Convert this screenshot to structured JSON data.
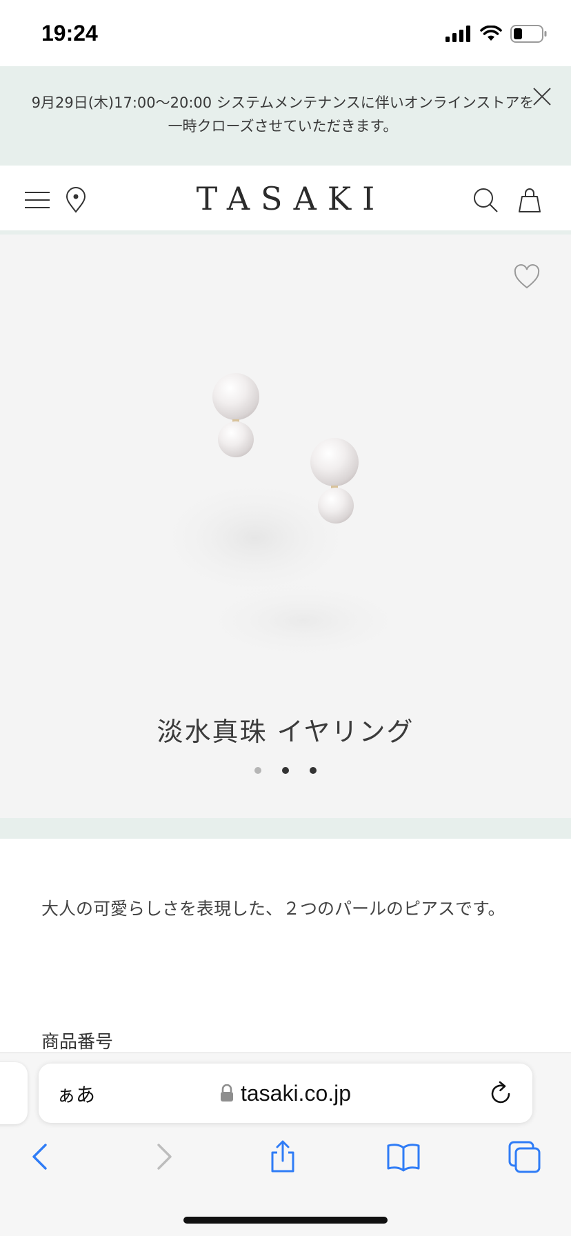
{
  "status_bar": {
    "time": "19:24"
  },
  "notice": {
    "message": "9月29日(木)17:00〜20:00 システムメンテナンスに伴いオンラインストアを一時クローズさせていただきます。"
  },
  "header": {
    "logo": "TASAKI",
    "icons": [
      "menu-icon",
      "location-pin-icon",
      "search-icon",
      "shopping-bag-icon"
    ]
  },
  "product": {
    "title": "淡水真珠 イヤリング",
    "carousel": {
      "total_slides": 3,
      "active_index": 0
    },
    "description": "大人の可愛らしさを表現した、２つのパールのピアスです。",
    "sku_label": "商品番号"
  },
  "browser": {
    "text_size_label": "ぁあ",
    "url": "tasaki.co.jp",
    "toolbar_icons": [
      "back-icon",
      "forward-icon",
      "share-icon",
      "bookmarks-icon",
      "tabs-icon"
    ]
  },
  "colors": {
    "accent_band": "#e7efec",
    "product_bg": "#f4f4f4",
    "browser_blue": "#2f7cf6"
  }
}
